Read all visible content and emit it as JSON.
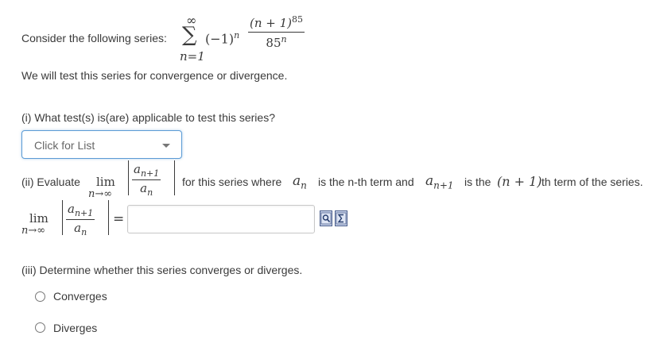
{
  "intro": {
    "prefix": "Consider the following series:",
    "sum_upper": "∞",
    "sum_symbol": "∑",
    "sum_lower": "n=1",
    "term_sign": "(−1)",
    "term_sign_exp": "n",
    "term_num": "(n + 1)",
    "term_num_exp": "85",
    "term_den": "85",
    "term_den_exp": "n",
    "statement": "We will test this series for convergence or divergence."
  },
  "part1": {
    "question": "(i) What test(s) is(are) applicable to test this series?",
    "dropdown_label": "Click for List"
  },
  "part2": {
    "prefix": "(ii) Evaluate",
    "lim": "lim",
    "lim_sub": "n→∞",
    "frac_num": "a",
    "frac_num_sub": "n+1",
    "frac_den": "a",
    "frac_den_sub": "n",
    "text_a": "for this series where",
    "an": "a",
    "an_sub": "n",
    "text_b": "is the n-th term and",
    "an1": "a",
    "an1_sub": "n+1",
    "text_c": "is the",
    "np1": "(n + 1)",
    "text_d": "th term of the series.",
    "equals": "=",
    "answer_value": "",
    "preview_icon": "preview-icon",
    "equation-editor-icon": "sigma-icon"
  },
  "part3": {
    "question": "(iii) Determine whether this series converges or diverges.",
    "options": [
      "Converges",
      "Diverges"
    ]
  }
}
